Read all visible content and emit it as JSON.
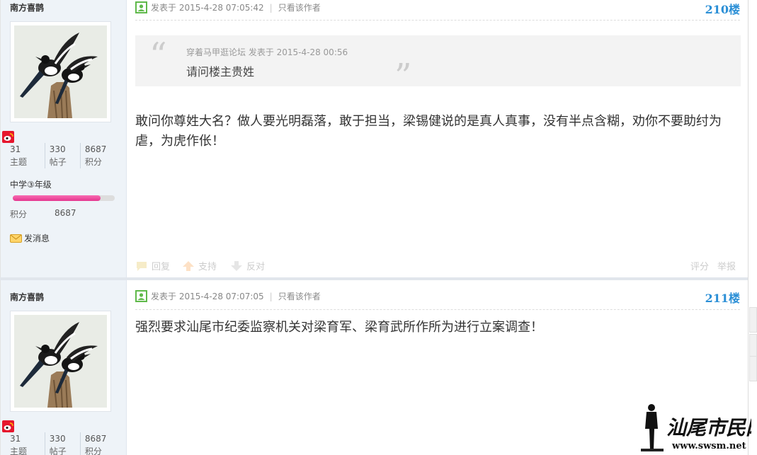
{
  "posts": [
    {
      "author": "南方喜鹊",
      "stats": [
        {
          "num": "31",
          "label": "主题"
        },
        {
          "num": "330",
          "label": "帖子"
        },
        {
          "num": "8687",
          "label": "积分"
        }
      ],
      "grade": "中学③年级",
      "grade_progress": 0.86,
      "points_label": "积分",
      "points_value": "8687",
      "message_label": "发消息",
      "posted_label": "发表于",
      "posted_time": "2015-4-28 07:05:42",
      "only_author": "只看该作者",
      "floor": "210楼",
      "quote": {
        "meta": "穿着马甲逛论坛 发表于 2015-4-28 00:56",
        "text": "请问楼主贵姓"
      },
      "content": "敢问你尊姓大名？做人要光明磊落，敢于担当，梁锡健说的是真人真事，没有半点含糊，劝你不要助纣为虐，为虎作伥！",
      "actions": {
        "reply": "回复",
        "support": "支持",
        "oppose": "反对",
        "rate": "评分",
        "report": "举报"
      }
    },
    {
      "author": "南方喜鹊",
      "stats": [
        {
          "num": "31",
          "label": "主题"
        },
        {
          "num": "330",
          "label": "帖子"
        },
        {
          "num": "8687",
          "label": "积分"
        }
      ],
      "posted_label": "发表于",
      "posted_time": "2015-4-28 07:07:05",
      "only_author": "只看该作者",
      "floor": "211楼",
      "content": "强烈要求汕尾市纪委监察机关对梁育军、梁育武所作所为进行立案调查！"
    }
  ],
  "watermark": {
    "name": "汕尾市民网",
    "url": "www.swsm.net"
  },
  "colors": {
    "accent": "#2b8fd6",
    "topbar": "#47a0ec",
    "sidebar": "#eef3f8",
    "grade_bar": "#e4358f"
  }
}
